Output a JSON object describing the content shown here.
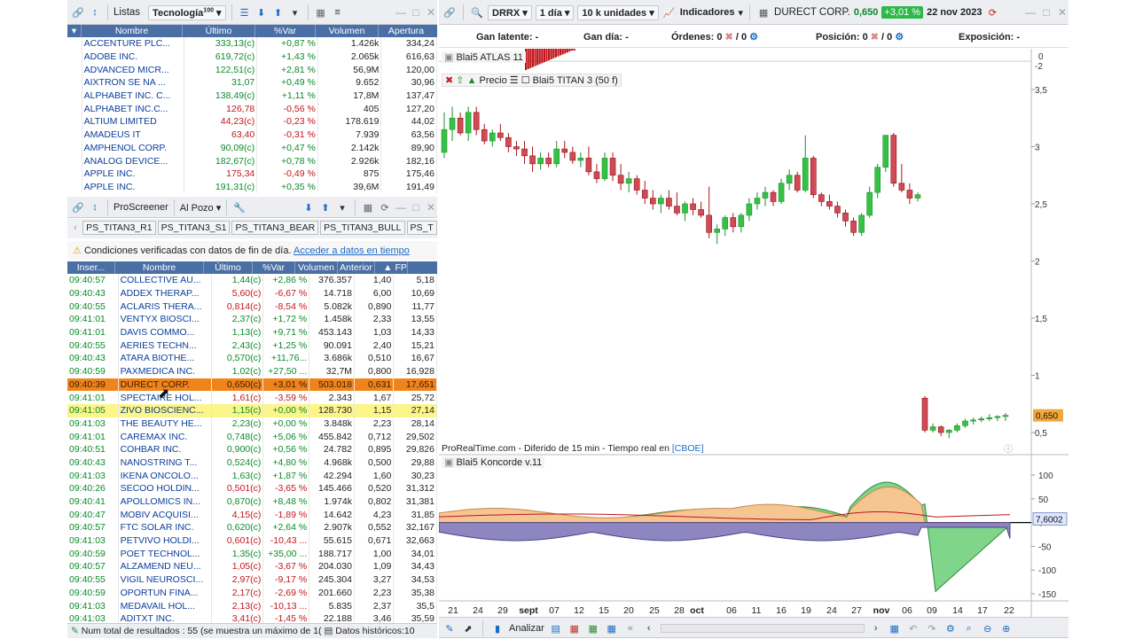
{
  "left_top": {
    "list_label": "Listas",
    "list_value": "Tecnología",
    "list_badge": "100"
  },
  "watch": {
    "headers": [
      "Nombre",
      "Último",
      "%Var",
      "Volumen",
      "Apertura"
    ],
    "rows": [
      [
        "ACCENTURE PLC...",
        "333,13(c)",
        "+0,87 %",
        "1.426k",
        "334,24"
      ],
      [
        "ADOBE INC.",
        "619,72(c)",
        "+1,43 %",
        "2.065k",
        "616,63"
      ],
      [
        "ADVANCED MICR...",
        "122,51(c)",
        "+2,81 %",
        "56,9M",
        "120,00"
      ],
      [
        "AIXTRON SE NA ...",
        "31,07",
        "+0,49 %",
        "9.652",
        "30,96"
      ],
      [
        "ALPHABET INC. C...",
        "138,49(c)",
        "+1,11 %",
        "17,8M",
        "137,47"
      ],
      [
        "ALPHABET INC.C...",
        "126,78",
        "-0,56 %",
        "405",
        "127,20"
      ],
      [
        "ALTIUM LIMITED",
        "44,23(c)",
        "-0,23 %",
        "178.619",
        "44,02"
      ],
      [
        "AMADEUS IT",
        "63,40",
        "-0,31 %",
        "7.939",
        "63,56"
      ],
      [
        "AMPHENOL CORP.",
        "90,09(c)",
        "+0,47 %",
        "2.142k",
        "89,90"
      ],
      [
        "ANALOG DEVICE...",
        "182,67(c)",
        "+0,78 %",
        "2.926k",
        "182,16"
      ],
      [
        "APPLE INC.",
        "175,34",
        "-0,49 %",
        "875",
        "175,46"
      ],
      [
        "APPLE INC.",
        "191,31(c)",
        "+0,35 %",
        "39,6M",
        "191,49"
      ]
    ]
  },
  "screener_bar": {
    "label": "ProScreener",
    "pozo": "Al Pozo"
  },
  "screener_tabs": [
    "PS_TITAN3_R1",
    "PS_TITAN3_S1",
    "PS_TITAN3_BEAR",
    "PS_TITAN3_BULL",
    "PS_T"
  ],
  "notice": {
    "text": "Condiciones verificadas con datos de fin de día.",
    "link": "Acceder a datos en tiempo"
  },
  "screener": {
    "headers": [
      "Inser...",
      "Nombre",
      "Último",
      "%Var",
      "Volumen",
      "Anterior",
      "FP"
    ],
    "rows": [
      [
        "09:40:57",
        "COLLECTIVE AU...",
        "1,44(c)",
        "+2,86 %",
        "376.357",
        "1,40",
        "5,18"
      ],
      [
        "09:40:43",
        "ADDEX THERAP...",
        "5,60(c)",
        "-6,67 %",
        "14.718",
        "6,00",
        "10,69"
      ],
      [
        "09:40:55",
        "ACLARIS THERA...",
        "0,814(c)",
        "-8,54 %",
        "5.082k",
        "0,890",
        "11,77"
      ],
      [
        "09:41:01",
        "VENTYX BIOSCI...",
        "2,37(c)",
        "+1,72 %",
        "1.458k",
        "2,33",
        "13,55"
      ],
      [
        "09:41:01",
        "DAVIS COMMO...",
        "1,13(c)",
        "+9,71 %",
        "453.143",
        "1,03",
        "14,33"
      ],
      [
        "09:40:55",
        "AERIES TECHN...",
        "2,43(c)",
        "+1,25 %",
        "90.091",
        "2,40",
        "15,21"
      ],
      [
        "09:40:43",
        "ATARA BIOTHE...",
        "0,570(c)",
        "+11,76...",
        "3.686k",
        "0,510",
        "16,67"
      ],
      [
        "09:40:59",
        "PAXMEDICA INC.",
        "1,02(c)",
        "+27,50 ...",
        "32,7M",
        "0,800",
        "16,928"
      ],
      [
        "09:40:39",
        "DURECT CORP.",
        "0,650(c)",
        "+3,01 %",
        "503.018",
        "0,631",
        "17,651"
      ],
      [
        "09:41:01",
        "SPECTAIRE HOL...",
        "1,61(c)",
        "-3,59 %",
        "2.343",
        "1,67",
        "25,72"
      ],
      [
        "09:41:05",
        "ZIVO BIOSCIENC...",
        "1,15(c)",
        "+0,00 %",
        "128.730",
        "1,15",
        "27,14"
      ],
      [
        "09:41:03",
        "THE BEAUTY HE...",
        "2,23(c)",
        "+0,00 %",
        "3.848k",
        "2,23",
        "28,14"
      ],
      [
        "09:41:01",
        "CAREMAX INC.",
        "0,748(c)",
        "+5,06 %",
        "455.842",
        "0,712",
        "29,502"
      ],
      [
        "09:40:51",
        "COHBAR INC.",
        "0,900(c)",
        "+0,56 %",
        "24.782",
        "0,895",
        "29,826"
      ],
      [
        "09:40:43",
        "NANOSTRING T...",
        "0,524(c)",
        "+4,80 %",
        "4.968k",
        "0,500",
        "29,88"
      ],
      [
        "09:41:03",
        "IKENA ONCOLO...",
        "1,63(c)",
        "+1,87 %",
        "42.294",
        "1,60",
        "30,23"
      ],
      [
        "09:40:26",
        "SECOO HOLDIN...",
        "0,501(c)",
        "-3,65 %",
        "145.466",
        "0,520",
        "31,312"
      ],
      [
        "09:40:41",
        "APOLLOMICS IN...",
        "0,870(c)",
        "+8,48 %",
        "1.974k",
        "0,802",
        "31,381"
      ],
      [
        "09:40:47",
        "MOBIV ACQUISI...",
        "4,15(c)",
        "-1,89 %",
        "14.642",
        "4,23",
        "31,85"
      ],
      [
        "09:40:57",
        "FTC SOLAR INC.",
        "0,620(c)",
        "+2,64 %",
        "2.907k",
        "0,552",
        "32,167"
      ],
      [
        "09:41:03",
        "PETVIVO HOLDI...",
        "0,601(c)",
        "-10,43 ...",
        "55.615",
        "0,671",
        "32,663"
      ],
      [
        "09:40:59",
        "POET TECHNOL...",
        "1,35(c)",
        "+35,00 ...",
        "188.717",
        "1,00",
        "34,01"
      ],
      [
        "09:40:57",
        "ALZAMEND NEU...",
        "1,05(c)",
        "-3,67 %",
        "204.030",
        "1,09",
        "34,43"
      ],
      [
        "09:40:55",
        "VIGIL NEUROSCI...",
        "2,97(c)",
        "-9,17 %",
        "245.304",
        "3,27",
        "34,53"
      ],
      [
        "09:40:59",
        "OPORTUN FINA...",
        "2,17(c)",
        "-2,69 %",
        "201.660",
        "2,23",
        "35,38"
      ],
      [
        "09:41:03",
        "MEDAVAIL HOL...",
        "2,13(c)",
        "-10,13 ...",
        "5.835",
        "2,37",
        "35,5"
      ],
      [
        "09:41:03",
        "ADITXT INC.",
        "3,41(c)",
        "-1,45 %",
        "22.188",
        "3,46",
        "35,59"
      ]
    ]
  },
  "left_status": {
    "results": "Num total de resultados : 55 (se muestra un máximo de 1(",
    "hist": "Datos históricos:10"
  },
  "chart_toolbar": {
    "ticker": "DRRX",
    "period": "1 día",
    "units": "10 k unidades",
    "indicators": "Indicadores",
    "name": "DURECT CORP.",
    "price": "0,650",
    "change": "+3,01 %",
    "date": "22 nov 2023"
  },
  "position_bar": {
    "latent_label": "Gan latente:",
    "latent": "-",
    "day_label": "Gan día:",
    "day": "-",
    "orders_label": "Órdenes:",
    "orders": "0",
    "orders_b": "/ 0",
    "pos_label": "Posición:",
    "pos": "0",
    "pos_b": "/ 0",
    "exp_label": "Exposición:",
    "exp": "-"
  },
  "panels": {
    "atlas": "Blai5 ATLAS 11",
    "price": "Precio",
    "titan": "Blai5 TITAN 3 (50 f)",
    "source": "ProRealTime.com - Diferido de 15 min - Tiempo real en",
    "source_link": "[CBOE]",
    "koncorde": "Blai5 Koncorde v.11"
  },
  "bottom": {
    "analyze": "Analizar"
  },
  "chart_data": [
    {
      "type": "candlestick",
      "title": "DRRX",
      "price_axis": [
        "3,5",
        "3",
        "2,5",
        "2",
        "1,5",
        "1",
        "0,5"
      ],
      "top_axis": [
        "0",
        "-2"
      ],
      "last_price": "0,650",
      "x_labels": [
        "21",
        "24",
        "29",
        "sept",
        "07",
        "12",
        "15",
        "20",
        "25",
        "28",
        "oct",
        "06",
        "11",
        "16",
        "19",
        "24",
        "27",
        "nov",
        "06",
        "09",
        "14",
        "17",
        "22"
      ],
      "ohlc": [
        [
          2.95,
          3.3,
          2.9,
          3.15
        ],
        [
          3.15,
          3.35,
          3.05,
          3.25
        ],
        [
          3.25,
          3.3,
          3.1,
          3.12
        ],
        [
          3.12,
          3.35,
          3.05,
          3.3
        ],
        [
          3.3,
          3.35,
          3.1,
          3.15
        ],
        [
          3.15,
          3.2,
          3.02,
          3.05
        ],
        [
          3.05,
          3.15,
          3.0,
          3.12
        ],
        [
          3.12,
          3.2,
          3.05,
          3.08
        ],
        [
          3.08,
          3.12,
          2.95,
          3.0
        ],
        [
          3.0,
          3.05,
          2.92,
          2.98
        ],
        [
          2.98,
          3.05,
          2.85,
          2.92
        ],
        [
          2.92,
          3.0,
          2.78,
          2.85
        ],
        [
          2.85,
          2.95,
          2.8,
          2.9
        ],
        [
          2.9,
          2.95,
          2.82,
          2.85
        ],
        [
          2.85,
          3.05,
          2.82,
          2.98
        ],
        [
          2.98,
          3.05,
          2.9,
          2.95
        ],
        [
          2.95,
          3.0,
          2.85,
          2.88
        ],
        [
          2.88,
          2.95,
          2.82,
          2.9
        ],
        [
          2.9,
          3.0,
          2.75,
          2.78
        ],
        [
          2.78,
          2.85,
          2.68,
          2.72
        ],
        [
          2.72,
          2.95,
          2.7,
          2.9
        ],
        [
          2.9,
          2.95,
          2.7,
          2.75
        ],
        [
          2.75,
          2.85,
          2.62,
          2.68
        ],
        [
          2.68,
          2.78,
          2.6,
          2.72
        ],
        [
          2.72,
          2.75,
          2.58,
          2.62
        ],
        [
          2.62,
          2.7,
          2.5,
          2.55
        ],
        [
          2.55,
          2.62,
          2.45,
          2.5
        ],
        [
          2.5,
          2.58,
          2.42,
          2.55
        ],
        [
          2.55,
          2.62,
          2.45,
          2.48
        ],
        [
          2.48,
          2.6,
          2.4,
          2.42
        ],
        [
          2.42,
          2.52,
          2.35,
          2.5
        ],
        [
          2.5,
          2.55,
          2.4,
          2.45
        ],
        [
          2.45,
          2.52,
          2.38,
          2.4
        ],
        [
          2.4,
          2.65,
          2.2,
          2.25
        ],
        [
          2.25,
          2.32,
          2.15,
          2.28
        ],
        [
          2.28,
          2.4,
          2.22,
          2.38
        ],
        [
          2.38,
          2.42,
          2.25,
          2.3
        ],
        [
          2.3,
          2.42,
          2.25,
          2.4
        ],
        [
          2.4,
          2.55,
          2.35,
          2.5
        ],
        [
          2.5,
          2.6,
          2.45,
          2.55
        ],
        [
          2.55,
          2.65,
          2.48,
          2.6
        ],
        [
          2.6,
          2.62,
          2.48,
          2.52
        ],
        [
          2.52,
          2.72,
          2.5,
          2.68
        ],
        [
          2.68,
          2.8,
          2.62,
          2.75
        ],
        [
          2.75,
          2.78,
          2.6,
          2.62
        ],
        [
          2.62,
          3.1,
          2.6,
          2.9
        ],
        [
          2.9,
          2.92,
          2.55,
          2.58
        ],
        [
          2.58,
          2.6,
          2.48,
          2.52
        ],
        [
          2.52,
          2.58,
          2.45,
          2.48
        ],
        [
          2.48,
          2.52,
          2.38,
          2.42
        ],
        [
          2.42,
          2.45,
          2.3,
          2.35
        ],
        [
          2.35,
          2.38,
          2.22,
          2.25
        ],
        [
          2.25,
          2.42,
          2.22,
          2.4
        ],
        [
          2.4,
          2.65,
          2.38,
          2.6
        ],
        [
          2.6,
          2.85,
          2.55,
          2.82
        ],
        [
          2.82,
          3.1,
          2.78,
          3.1
        ],
        [
          3.1,
          3.12,
          2.65,
          2.68
        ],
        [
          2.68,
          2.85,
          2.6,
          2.62
        ],
        [
          2.62,
          2.68,
          2.5,
          2.55
        ],
        [
          2.55,
          2.6,
          2.52,
          2.58
        ],
        [
          0.8,
          0.82,
          0.5,
          0.52
        ],
        [
          0.52,
          0.58,
          0.5,
          0.55
        ],
        [
          0.55,
          0.56,
          0.47,
          0.5
        ],
        [
          0.5,
          0.53,
          0.45,
          0.52
        ],
        [
          0.52,
          0.58,
          0.5,
          0.56
        ],
        [
          0.56,
          0.62,
          0.54,
          0.6
        ],
        [
          0.6,
          0.63,
          0.57,
          0.61
        ],
        [
          0.61,
          0.64,
          0.59,
          0.62
        ],
        [
          0.62,
          0.66,
          0.6,
          0.63
        ],
        [
          0.63,
          0.65,
          0.6,
          0.64
        ],
        [
          0.64,
          0.67,
          0.6,
          0.65
        ]
      ]
    },
    {
      "type": "area",
      "title": "Blai5 Koncorde v.11",
      "y_axis": [
        "100",
        "50",
        "0",
        "-50",
        "-100",
        "-150"
      ],
      "last_value": "7,6002"
    }
  ]
}
